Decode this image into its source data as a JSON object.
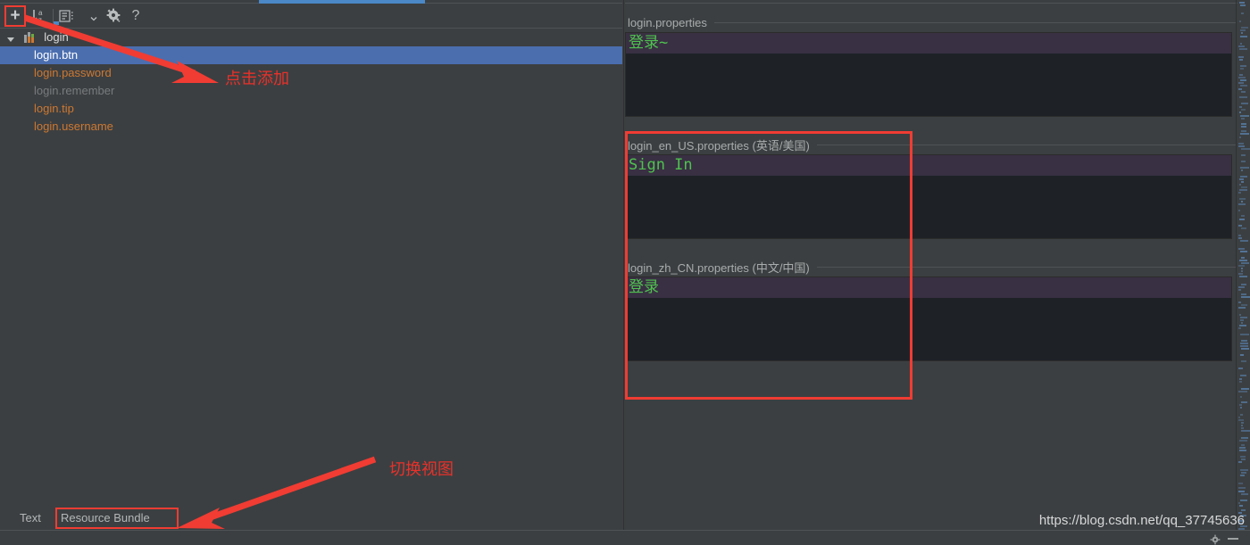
{
  "toolbar": {
    "add_label": "+",
    "add_icon": "plus-icon",
    "sort_icon": "sort-alphabetical-icon",
    "group_icon": "group-list-icon",
    "group_dropdown_icon": "chevron-down-icon",
    "settings_icon": "gear-icon",
    "help_label": "?"
  },
  "tree": {
    "root": {
      "label": "login",
      "icon": "resource-bundle-icon",
      "expanded": true,
      "caret_icon": "caret-down-icon"
    },
    "items": [
      {
        "label": "login.btn",
        "state": "selected"
      },
      {
        "label": "login.password",
        "state": "normal"
      },
      {
        "label": "login.remember",
        "state": "disabled"
      },
      {
        "label": "login.tip",
        "state": "normal"
      },
      {
        "label": "login.username",
        "state": "normal"
      }
    ]
  },
  "bottom_tabs": {
    "text_label": "Text",
    "bundle_label": "Resource Bundle",
    "active": "Resource Bundle"
  },
  "bundle_editors": [
    {
      "title": "login.properties",
      "locale": "",
      "value": "登录~",
      "focused": true
    },
    {
      "title": "login_en_US.properties",
      "locale": "(英语/美国)",
      "value": "Sign In",
      "focused": false
    },
    {
      "title": "login_zh_CN.properties",
      "locale": "(中文/中国)",
      "value": "登录",
      "focused": false
    }
  ],
  "annotations": [
    {
      "text": "点击添加",
      "name": "annotation-click-add"
    },
    {
      "text": "切换视图",
      "name": "annotation-switch-view"
    }
  ],
  "watermark": "https://blog.csdn.net/qq_37745636",
  "colors": {
    "accent_blue": "#4b6eaf",
    "tab_underline": "#4a88c7",
    "annotation_red": "#f03c33",
    "key_orange": "#cc7832",
    "value_green": "#4fc24f",
    "panel_bg": "#3c3f41",
    "editor_bg": "#1e2227",
    "caret_line": "#393043",
    "disabled_gray": "#787b7d"
  }
}
